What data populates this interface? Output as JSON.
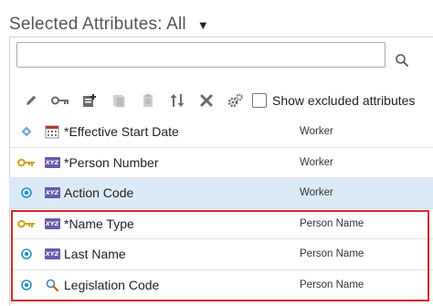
{
  "header": {
    "title": "Selected Attributes: All"
  },
  "search": {
    "value": "",
    "placeholder": ""
  },
  "toolbar": {
    "buttons": [
      "edit-icon",
      "key-icon",
      "add-attribute-icon",
      "copy-icon",
      "paste-icon",
      "sort-icon",
      "delete-icon",
      "settings-icon"
    ],
    "show_excluded_label": "Show excluded attributes"
  },
  "rows": [
    {
      "indicator": "diamond-icon",
      "type_icon": "calendar-icon",
      "name": "*Effective Start Date",
      "object": "Worker",
      "selected": false
    },
    {
      "indicator": "key-icon",
      "type_icon": "xyz-icon",
      "name": "*Person Number",
      "object": "Worker",
      "selected": false
    },
    {
      "indicator": "target-icon",
      "type_icon": "xyz-icon",
      "name": "Action Code",
      "object": "Worker",
      "selected": true
    },
    {
      "indicator": "key-icon",
      "type_icon": "xyz-icon",
      "name": "*Name Type",
      "object": "Person Name",
      "selected": false
    },
    {
      "indicator": "target-icon",
      "type_icon": "xyz-icon",
      "name": "Last Name",
      "object": "Person Name",
      "selected": false
    },
    {
      "indicator": "target-icon",
      "type_icon": "lookup-icon",
      "name": "Legislation Code",
      "object": "Person Name",
      "selected": false
    }
  ],
  "type_icon_text": "XYZ",
  "colors": {
    "selected_row": "#dbeaf7",
    "highlight_border": "#d22c2c",
    "key": "#d4a017",
    "target": "#2a8fc9"
  }
}
